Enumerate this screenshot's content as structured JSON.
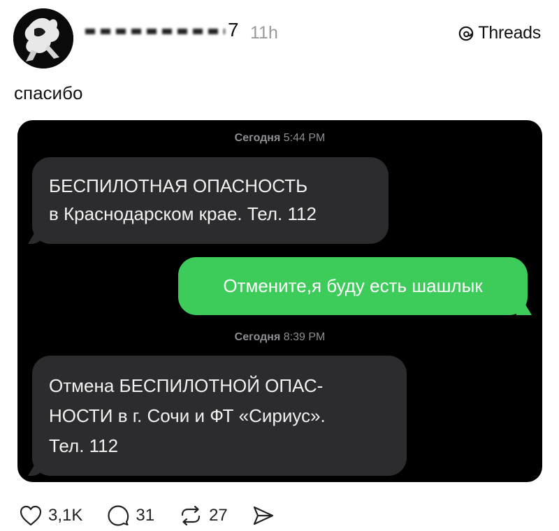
{
  "header": {
    "username_tail": "7",
    "time": "11h",
    "brand": "Threads",
    "brand_icon": "threads-logo-icon"
  },
  "post": {
    "text": "спасибо"
  },
  "screenshot": {
    "stamp1_day": "Сегодня",
    "stamp1_time": "5:44 PM",
    "msg1_line1": "БЕСПИЛОТНАЯ ОПАСНОСТЬ",
    "msg1_line2": "в Краснодарском крае. Тел. 112",
    "msg2": "Отмените,я буду есть шашлык",
    "stamp2_day": "Сегодня",
    "stamp2_time": "8:39 PM",
    "msg3_line1": "Отмена БЕСПИЛОТНОЙ ОПАС-",
    "msg3_line2": "НОСТИ в г. Сочи и ФТ «Сириус».",
    "msg3_line3": "Тел. 112",
    "incoming_color": "#2c2c2e",
    "outgoing_color": "#3dcc5a"
  },
  "actions": {
    "likes": "3,1K",
    "replies": "31",
    "reposts": "27"
  }
}
